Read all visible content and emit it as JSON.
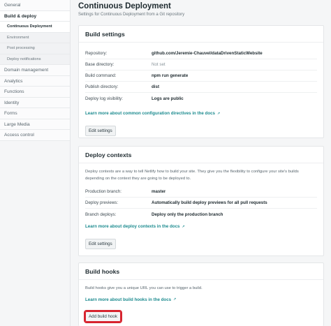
{
  "sidebar": {
    "items": [
      {
        "label": "General"
      },
      {
        "label": "Build & deploy"
      },
      {
        "label": "Domain management"
      },
      {
        "label": "Analytics"
      },
      {
        "label": "Functions"
      },
      {
        "label": "Identity"
      },
      {
        "label": "Forms"
      },
      {
        "label": "Large Media"
      },
      {
        "label": "Access control"
      }
    ],
    "sub_items": [
      {
        "label": "Continuous Deployment"
      },
      {
        "label": "Environment"
      },
      {
        "label": "Post processing"
      },
      {
        "label": "Deploy notifications"
      }
    ]
  },
  "header": {
    "title": "Continuous Deployment",
    "subtitle": "Settings for Continuous Deployment from a Git repository"
  },
  "build_settings": {
    "title": "Build settings",
    "rows": [
      {
        "key": "Repository:",
        "value": "github.com/Jeremie-Chauvel/dataDrivenStaticWebsite"
      },
      {
        "key": "Base directory:",
        "value": "Not set"
      },
      {
        "key": "Build command:",
        "value": "npm run generate"
      },
      {
        "key": "Publish directory:",
        "value": "dist"
      },
      {
        "key": "Deploy log visibility:",
        "value": "Logs are public"
      }
    ],
    "link": "Learn more about common configuration directives in the docs",
    "button": "Edit settings"
  },
  "deploy_contexts": {
    "title": "Deploy contexts",
    "description": "Deploy contexts are a way to tell Netlify how to build your site. They give you the flexibility to configure your site's builds depending on the context they are going to be deployed to.",
    "rows": [
      {
        "key": "Production branch:",
        "value": "master"
      },
      {
        "key": "Deploy previews:",
        "value": "Automatically build deploy previews for all pull requests"
      },
      {
        "key": "Branch deploys:",
        "value": "Deploy only the production branch"
      }
    ],
    "link": "Learn more about deploy contexts in the docs",
    "button": "Edit settings"
  },
  "build_hooks": {
    "title": "Build hooks",
    "description": "Build hooks give you a unique URL you can use to trigger a build.",
    "link": "Learn more about build hooks in the docs",
    "button": "Add build hook"
  },
  "colors": {
    "accent_link": "#1c8b8f",
    "highlight": "#d7242f"
  }
}
